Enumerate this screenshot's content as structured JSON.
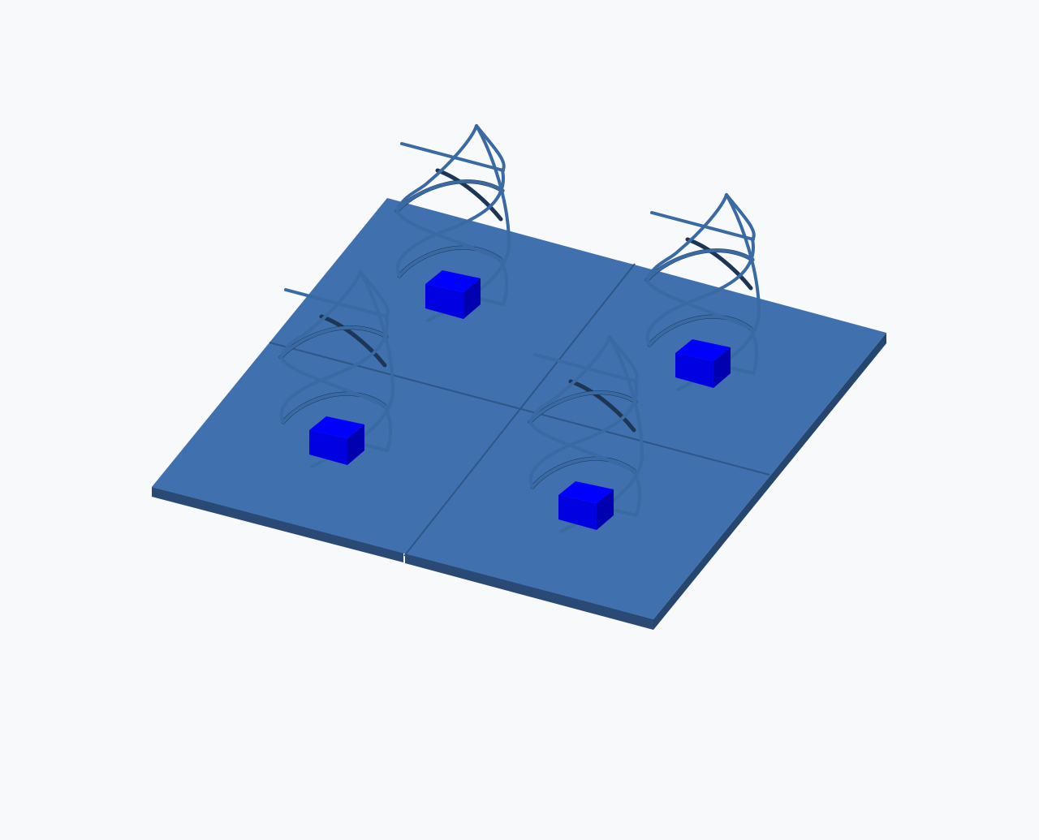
{
  "viewport": {
    "background_color": "#f8f9fa"
  },
  "model": {
    "plate_color": "#4070ad",
    "plate_edge_color": "#2a4a75",
    "seam_color": "#2e5688",
    "helix_color": "#3a6aa3",
    "helix_shadow_color": "#1e3656",
    "feed_block_color": "#0000ff",
    "feed_block_dark_color": "#0000b0",
    "tile_grid": [
      2,
      2
    ],
    "element_count": 4
  }
}
